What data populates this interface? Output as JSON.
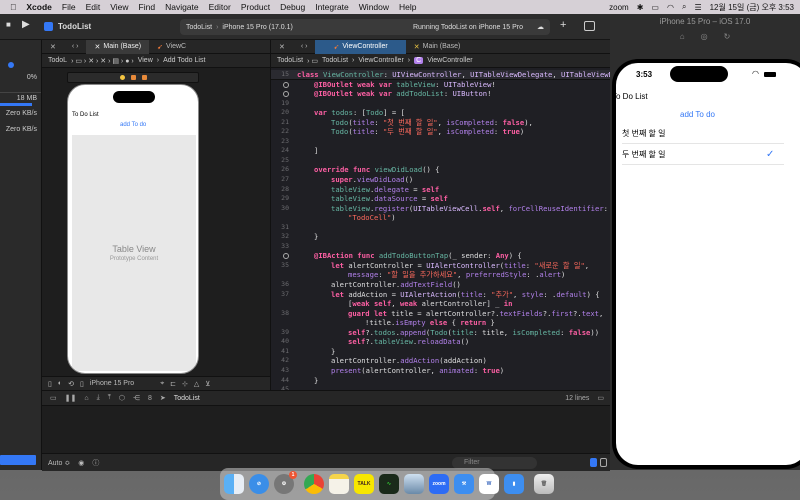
{
  "menubar": {
    "app": "Xcode",
    "items": [
      "File",
      "Edit",
      "View",
      "Find",
      "Navigate",
      "Editor",
      "Product",
      "Debug",
      "Integrate",
      "Window",
      "Help"
    ],
    "zoom": "zoom",
    "clock": "12월 15일 (금) 오후 3:53"
  },
  "toolbar": {
    "project": "TodoList",
    "scheme": "TodoList",
    "device": "iPhone 15 Pro (17.0.1)",
    "status": "Running TodoList on iPhone 15 Pro"
  },
  "navigator": {
    "cpu": "0%",
    "memory": "18 MB",
    "disk": "Zero KB/s",
    "network": "Zero KB/s"
  },
  "left_editor": {
    "tabs": [
      "Main (Base)",
      "ViewC"
    ],
    "jump": [
      "TodoL",
      "View",
      "Add Todo List"
    ],
    "phone": {
      "title": "To Do List",
      "button": "add To do",
      "table_title": "Table View",
      "table_sub": "Prototype Content"
    },
    "device_label": "iPhone 15 Pro"
  },
  "code_editor": {
    "tabs": [
      "ViewController",
      "Main (Base)"
    ],
    "jump": [
      "TodoList",
      "TodoList",
      "ViewController",
      "ViewController"
    ],
    "lines": [
      {
        "n": "15",
        "hl": true,
        "i": 0,
        "tk": [
          [
            "class ",
            "k"
          ],
          [
            "ViewController",
            "d"
          ],
          [
            ": ",
            "x"
          ],
          [
            "UIViewController",
            "t"
          ],
          [
            ", ",
            "x"
          ],
          [
            "UITableViewDelegate",
            "t"
          ],
          [
            ", ",
            "x"
          ],
          [
            "UITableViewDat…",
            "t"
          ]
        ]
      },
      {
        "n": "bp",
        "i": 1,
        "tk": [
          [
            "@IBOutlet weak var ",
            "k"
          ],
          [
            "tableView",
            "d"
          ],
          [
            ": ",
            "x"
          ],
          [
            "UITableView",
            "t"
          ],
          [
            "!",
            "x"
          ]
        ]
      },
      {
        "n": "bp",
        "i": 1,
        "tk": [
          [
            "@IBOutlet weak var ",
            "k"
          ],
          [
            "addTodoList",
            "d"
          ],
          [
            ": ",
            "x"
          ],
          [
            "UIButton",
            "t"
          ],
          [
            "!",
            "x"
          ]
        ]
      },
      {
        "n": "19",
        "i": 0,
        "tk": []
      },
      {
        "n": "20",
        "i": 1,
        "tk": [
          [
            "var ",
            "k"
          ],
          [
            "todos",
            "d"
          ],
          [
            ": [",
            "x"
          ],
          [
            "Todo",
            "d"
          ],
          [
            "] = [",
            "x"
          ]
        ]
      },
      {
        "n": "21",
        "i": 2,
        "tk": [
          [
            "Todo",
            "d"
          ],
          [
            "(",
            "x"
          ],
          [
            "title",
            "p"
          ],
          [
            ": ",
            "x"
          ],
          [
            "\"첫 번째 할 일\"",
            "s"
          ],
          [
            ", ",
            "x"
          ],
          [
            "isCompleted",
            "p"
          ],
          [
            ": ",
            "x"
          ],
          [
            "false",
            "k"
          ],
          [
            "),",
            "x"
          ]
        ]
      },
      {
        "n": "22",
        "i": 2,
        "tk": [
          [
            "Todo",
            "d"
          ],
          [
            "(",
            "x"
          ],
          [
            "title",
            "p"
          ],
          [
            ": ",
            "x"
          ],
          [
            "\"두 번째 할 일\"",
            "s"
          ],
          [
            ", ",
            "x"
          ],
          [
            "isCompleted",
            "p"
          ],
          [
            ": ",
            "x"
          ],
          [
            "true",
            "k"
          ],
          [
            ")",
            "x"
          ]
        ]
      },
      {
        "n": "23",
        "i": 0,
        "tk": []
      },
      {
        "n": "24",
        "i": 1,
        "tk": [
          [
            "]",
            "x"
          ]
        ]
      },
      {
        "n": "25",
        "i": 0,
        "tk": []
      },
      {
        "n": "26",
        "i": 1,
        "tk": [
          [
            "override func ",
            "k"
          ],
          [
            "viewDidLoad",
            "d"
          ],
          [
            "() {",
            "x"
          ]
        ]
      },
      {
        "n": "27",
        "i": 2,
        "tk": [
          [
            "super",
            "k"
          ],
          [
            ".",
            "x"
          ],
          [
            "viewDidLoad",
            "p"
          ],
          [
            "()",
            "x"
          ]
        ]
      },
      {
        "n": "28",
        "i": 2,
        "tk": [
          [
            "tableView",
            "d"
          ],
          [
            ".",
            "x"
          ],
          [
            "delegate",
            "p"
          ],
          [
            " = ",
            "x"
          ],
          [
            "self",
            "k"
          ]
        ]
      },
      {
        "n": "29",
        "i": 2,
        "tk": [
          [
            "tableView",
            "d"
          ],
          [
            ".",
            "x"
          ],
          [
            "dataSource",
            "p"
          ],
          [
            " = ",
            "x"
          ],
          [
            "self",
            "k"
          ]
        ]
      },
      {
        "n": "30",
        "i": 2,
        "tk": [
          [
            "tableView",
            "d"
          ],
          [
            ".",
            "x"
          ],
          [
            "register",
            "p"
          ],
          [
            "(",
            "x"
          ],
          [
            "UITableViewCell",
            "t"
          ],
          [
            ".",
            "x"
          ],
          [
            "self",
            "k"
          ],
          [
            ", ",
            "x"
          ],
          [
            "forCellReuseIdentifier",
            "p"
          ],
          [
            ":",
            "x"
          ]
        ]
      },
      {
        "n": "",
        "i": 3,
        "tk": [
          [
            "\"TodoCell\"",
            "s"
          ],
          [
            ")",
            "x"
          ]
        ]
      },
      {
        "n": "31",
        "i": 0,
        "tk": []
      },
      {
        "n": "32",
        "i": 1,
        "tk": [
          [
            "}",
            "x"
          ]
        ]
      },
      {
        "n": "33",
        "i": 0,
        "tk": []
      },
      {
        "n": "bp",
        "i": 1,
        "tk": [
          [
            "@IBAction func ",
            "k"
          ],
          [
            "addTodoButtonTap",
            "d"
          ],
          [
            "(_ sender: ",
            "x"
          ],
          [
            "Any",
            "k"
          ],
          [
            ") {",
            "x"
          ]
        ]
      },
      {
        "n": "35",
        "i": 2,
        "tk": [
          [
            "let ",
            "k"
          ],
          [
            "alertController = ",
            "x"
          ],
          [
            "UIAlertController",
            "t"
          ],
          [
            "(",
            "x"
          ],
          [
            "title",
            "p"
          ],
          [
            ": ",
            "x"
          ],
          [
            "\"새로운 할 일\"",
            "s"
          ],
          [
            ",",
            "x"
          ]
        ]
      },
      {
        "n": "",
        "i": 3,
        "tk": [
          [
            "message",
            "p"
          ],
          [
            ": ",
            "x"
          ],
          [
            "\"할 일을 추가하세요\"",
            "s"
          ],
          [
            ", ",
            "x"
          ],
          [
            "preferredStyle",
            "p"
          ],
          [
            ": .",
            "x"
          ],
          [
            "alert",
            "p"
          ],
          [
            ")",
            "x"
          ]
        ]
      },
      {
        "n": "36",
        "i": 2,
        "tk": [
          [
            "alertController.",
            "x"
          ],
          [
            "addTextField",
            "p"
          ],
          [
            "()",
            "x"
          ]
        ]
      },
      {
        "n": "37",
        "i": 2,
        "tk": [
          [
            "let ",
            "k"
          ],
          [
            "addAction = ",
            "x"
          ],
          [
            "UIAlertAction",
            "t"
          ],
          [
            "(",
            "x"
          ],
          [
            "title",
            "p"
          ],
          [
            ": ",
            "x"
          ],
          [
            "\"추가\"",
            "s"
          ],
          [
            ", ",
            "x"
          ],
          [
            "style",
            "p"
          ],
          [
            ": .",
            "x"
          ],
          [
            "default",
            "p"
          ],
          [
            ") {",
            "x"
          ]
        ]
      },
      {
        "n": "",
        "i": 3,
        "tk": [
          [
            "[",
            "x"
          ],
          [
            "weak self",
            "k"
          ],
          [
            ", ",
            "x"
          ],
          [
            "weak ",
            "k"
          ],
          [
            "alertController] _ ",
            "x"
          ],
          [
            "in",
            "k"
          ]
        ]
      },
      {
        "n": "38",
        "i": 3,
        "tk": [
          [
            "guard let ",
            "k"
          ],
          [
            "title = alertController?.",
            "x"
          ],
          [
            "textFields",
            "p"
          ],
          [
            "?.",
            "x"
          ],
          [
            "first",
            "p"
          ],
          [
            "?.",
            "x"
          ],
          [
            "text",
            "p"
          ],
          [
            ",",
            "x"
          ]
        ]
      },
      {
        "n": "",
        "i": 4,
        "tk": [
          [
            "!title.",
            "x"
          ],
          [
            "isEmpty ",
            "p"
          ],
          [
            "else ",
            "k"
          ],
          [
            "{ ",
            "x"
          ],
          [
            "return ",
            "k"
          ],
          [
            "}",
            "x"
          ]
        ]
      },
      {
        "n": "39",
        "i": 3,
        "tk": [
          [
            "self",
            "k"
          ],
          [
            "?.",
            "x"
          ],
          [
            "todos",
            "d"
          ],
          [
            ".",
            "x"
          ],
          [
            "append",
            "p"
          ],
          [
            "(",
            "x"
          ],
          [
            "Todo",
            "d"
          ],
          [
            "(",
            "x"
          ],
          [
            "title",
            "d"
          ],
          [
            ": title, ",
            "x"
          ],
          [
            "isCompleted",
            "d"
          ],
          [
            ": ",
            "x"
          ],
          [
            "false",
            "k"
          ],
          [
            "))",
            "x"
          ]
        ]
      },
      {
        "n": "40",
        "i": 3,
        "tk": [
          [
            "self",
            "k"
          ],
          [
            "?.",
            "x"
          ],
          [
            "tableView",
            "d"
          ],
          [
            ".",
            "x"
          ],
          [
            "reloadData",
            "p"
          ],
          [
            "()",
            "x"
          ]
        ]
      },
      {
        "n": "41",
        "i": 2,
        "tk": [
          [
            "}",
            "x"
          ]
        ]
      },
      {
        "n": "42",
        "i": 2,
        "tk": [
          [
            "alertController.",
            "x"
          ],
          [
            "addAction",
            "p"
          ],
          [
            "(addAction)",
            "x"
          ]
        ]
      },
      {
        "n": "43",
        "i": 2,
        "tk": [
          [
            "present",
            "p"
          ],
          [
            "(alertController, ",
            "x"
          ],
          [
            "animated",
            "p"
          ],
          [
            ": ",
            "x"
          ],
          [
            "true",
            "k"
          ],
          [
            ")",
            "x"
          ]
        ]
      },
      {
        "n": "44",
        "i": 1,
        "tk": [
          [
            "}",
            "x"
          ]
        ]
      },
      {
        "n": "45",
        "i": 0,
        "tk": []
      }
    ]
  },
  "debug": {
    "target": "TodoList",
    "line_count": "12 lines",
    "auto": "Auto ≎",
    "filter_placeholder": "Filter"
  },
  "simulator": {
    "title": "iPhone 15 Pro – iOS 17.0",
    "time": "3:53",
    "heading": "To Do List",
    "add_button": "add To do",
    "todos": [
      {
        "title": "첫 번째 할 일",
        "completed": false
      },
      {
        "title": "두 번째 할 일",
        "completed": true
      }
    ],
    "check": "✓"
  },
  "dock": {
    "apps": [
      "Finder",
      "Safari",
      "System Settings",
      "Chrome",
      "Notes",
      "KakaoTalk",
      "Activity Monitor",
      "Preview",
      "Zoom",
      "Xcode",
      "Word",
      "Simulator",
      "Trash"
    ],
    "badge": "1",
    "zoom_label": "zoom",
    "talk_label": "TALK"
  },
  "colors": {
    "accent": "#3478f6",
    "keyword": "#fc5fa3",
    "string": "#fc6a5d"
  }
}
